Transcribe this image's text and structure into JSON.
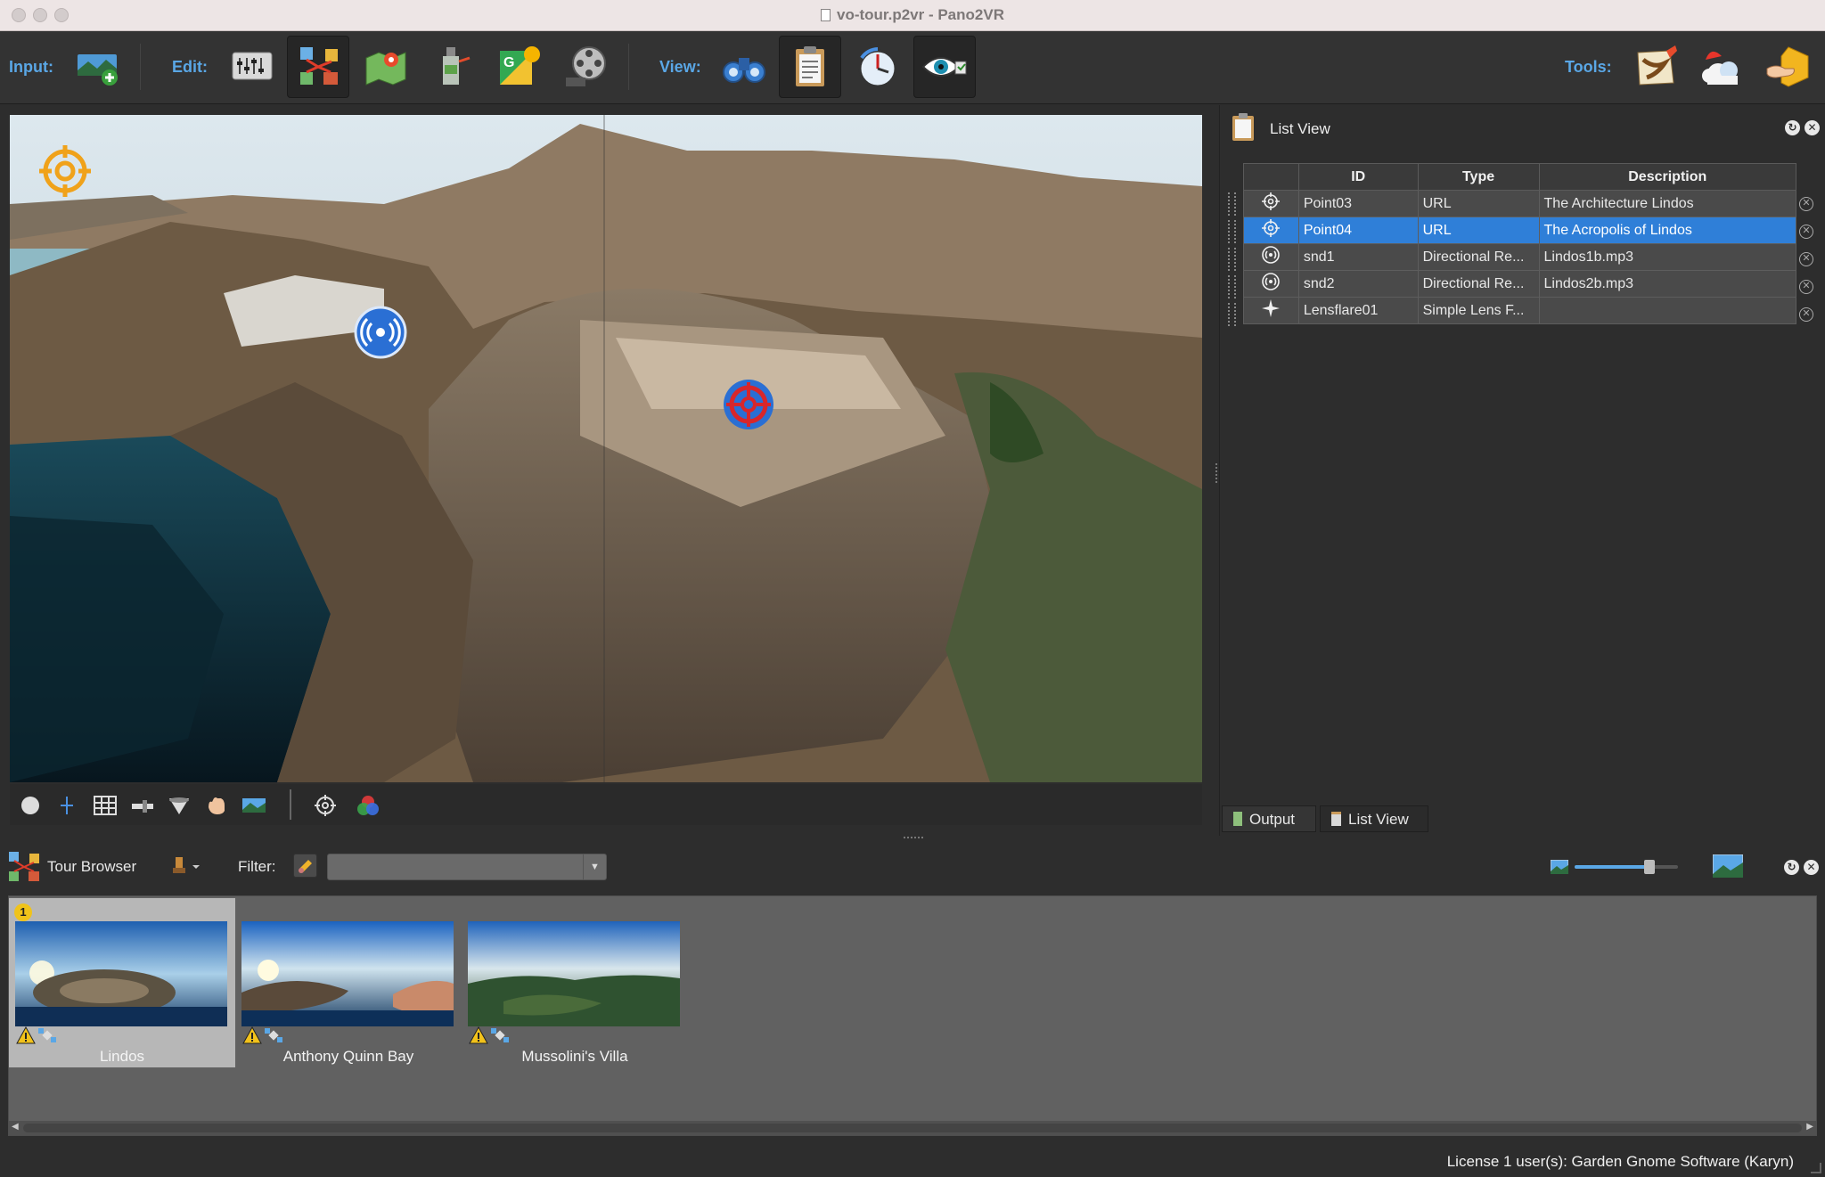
{
  "window": {
    "title": "vo-tour.p2vr - Pano2VR"
  },
  "toolbar": {
    "input_label": "Input:",
    "edit_label": "Edit:",
    "view_label": "View:",
    "tools_label": "Tools:",
    "input_buttons": [
      "add-panorama"
    ],
    "edit_buttons": [
      "viewing-parameters",
      "tour-editor",
      "map-editor",
      "patch-input",
      "google-maps",
      "animation"
    ],
    "view_buttons": [
      "binoculars",
      "list-view",
      "compass-dial",
      "eye-editor"
    ],
    "tools_buttons": [
      "map-tool",
      "weather-tool",
      "hand-tool"
    ]
  },
  "list_view": {
    "title": "List View",
    "columns": [
      "ID",
      "Type",
      "Description"
    ],
    "rows": [
      {
        "icon": "crosshair-icon",
        "id": "Point03",
        "type": "URL",
        "description": "The Architecture Lindos",
        "selected": false
      },
      {
        "icon": "crosshair-icon",
        "id": "Point04",
        "type": "URL",
        "description": "The Acropolis of Lindos",
        "selected": true
      },
      {
        "icon": "sound-icon",
        "id": "snd1",
        "type": "Directional Re...",
        "description": "Lindos1b.mp3",
        "selected": false
      },
      {
        "icon": "sound-icon",
        "id": "snd2",
        "type": "Directional Re...",
        "description": "Lindos2b.mp3",
        "selected": false
      },
      {
        "icon": "sparkle-icon",
        "id": "Lensflare01",
        "type": "Simple Lens F...",
        "description": "",
        "selected": false
      }
    ]
  },
  "panel_tabs": {
    "output": "Output",
    "list_view": "List View"
  },
  "tour_browser": {
    "title": "Tour Browser",
    "filter_label": "Filter:",
    "filter_value": "",
    "scenes": [
      {
        "name": "Lindos",
        "selected": true,
        "badge": "1"
      },
      {
        "name": "Anthony Quinn Bay",
        "selected": false
      },
      {
        "name": "Mussolini's Villa",
        "selected": false
      }
    ],
    "zoom_level": 0.72
  },
  "status": {
    "license": "License 1 user(s): Garden Gnome Software (Karyn)"
  },
  "colors": {
    "accent": "#5aa7e6",
    "selection": "#2f7fd8",
    "hotspot_red": "#d8262b",
    "sound_blue": "#2a6fd4"
  }
}
